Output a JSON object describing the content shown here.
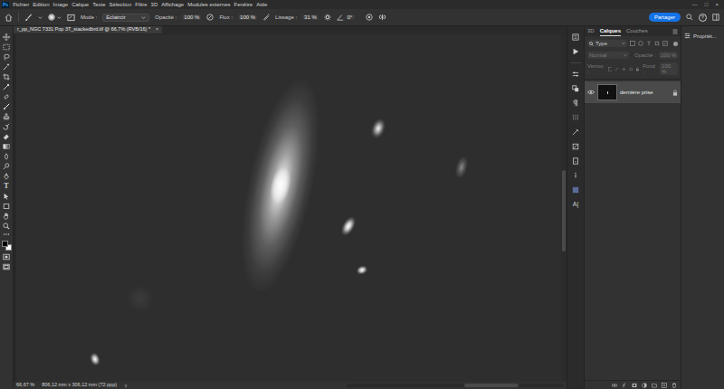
{
  "app": {
    "logo": "Ps"
  },
  "menu": [
    "Fichier",
    "Edition",
    "Image",
    "Calque",
    "Texte",
    "Sélection",
    "Filtre",
    "3D",
    "Affichage",
    "Modules externes",
    "Fenêtre",
    "Aide"
  ],
  "window_controls": [
    "—",
    "□",
    "×"
  ],
  "options": {
    "mode_label": "Mode :",
    "mode": "Eclaircir",
    "opacity_label": "Opacité :",
    "opacity": "100 %",
    "flow_label": "Flux :",
    "flow": "100 %",
    "smoothing_label": "Lissage :",
    "smoothing": "31 %",
    "angle": "0°",
    "share": "Partager",
    "help": "?"
  },
  "toolbar": {
    "type_tool": "T"
  },
  "document_tab": {
    "title": "r_pp_NGC 7331 Pop 3T_stackedbrd.tif @ 66,7% (RVB/16) *",
    "close": "×"
  },
  "status_bar": {
    "zoom": "66,67 %",
    "info": "806,12 mm x 306,12 mm (72 ppp)"
  },
  "icon_column": {
    "character": "A|"
  },
  "panel": {
    "tabs": [
      {
        "label": "3D",
        "selected": false
      },
      {
        "label": "Calques",
        "selected": true
      },
      {
        "label": "Couches",
        "selected": false
      }
    ],
    "filter": "Type",
    "blend": {
      "mode": "Normal",
      "opacity_label": "Opacité :",
      "opacity": "100 %",
      "disabled": true
    },
    "lock": {
      "label": "Verrou :",
      "fill_label": "Fond :",
      "fill": "100 %",
      "disabled": true
    },
    "layers": [
      {
        "name": "dernière prise",
        "visible": true,
        "selected": true,
        "locked": true
      }
    ]
  },
  "properties": {
    "label": "Propriét..."
  }
}
